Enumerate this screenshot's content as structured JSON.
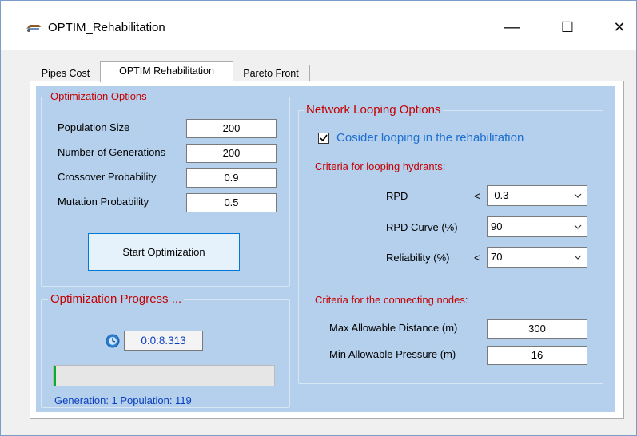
{
  "window": {
    "title": "OPTIM_Rehabilitation",
    "icon": "pipe-app-icon",
    "controls": {
      "minimize": "—",
      "maximize": "☐",
      "close": "✕"
    }
  },
  "tabs": [
    {
      "label": "Pipes Cost",
      "active": false
    },
    {
      "label": "OPTIM Rehabilitation",
      "active": true
    },
    {
      "label": "Pareto Front",
      "active": false
    }
  ],
  "optimization_options": {
    "title": "Optimization Options",
    "fields": [
      {
        "label": "Population Size",
        "value": "200"
      },
      {
        "label": "Number of Generations",
        "value": "200"
      },
      {
        "label": "Crossover Probability",
        "value": "0.9"
      },
      {
        "label": "Mutation Probability",
        "value": "0.5"
      }
    ],
    "start_button": "Start Optimization"
  },
  "progress": {
    "title": "Optimization Progress ...",
    "timer": "0:0:8.313",
    "progress_fraction": 0.01,
    "status": "Generation: 1  Population: 119"
  },
  "looping": {
    "title": "Network Looping Options",
    "checkbox_label": "Cosider looping in the rehabilitation",
    "checkbox_checked": true,
    "hydrant_criteria_title": "Criteria for looping hydrants:",
    "rpd": {
      "label": "RPD",
      "op": "<",
      "value": "-0.3"
    },
    "rpd_curve": {
      "label": "RPD Curve (%)",
      "value": "90"
    },
    "reliability": {
      "label": "Reliability (%)",
      "op": "<",
      "value": "70"
    },
    "node_criteria_title": "Criteria for the connecting nodes:",
    "max_distance": {
      "label": "Max Allowable Distance (m)",
      "value": "300"
    },
    "min_pressure": {
      "label": "Min Allowable Pressure (m)",
      "value": "16"
    }
  },
  "colors": {
    "panel_bg": "#b4d0ec",
    "group_title": "#c40000",
    "status_text": "#0b3fbf",
    "checkbox_label": "#1f6fd1",
    "progress_fill": "#06b025"
  }
}
